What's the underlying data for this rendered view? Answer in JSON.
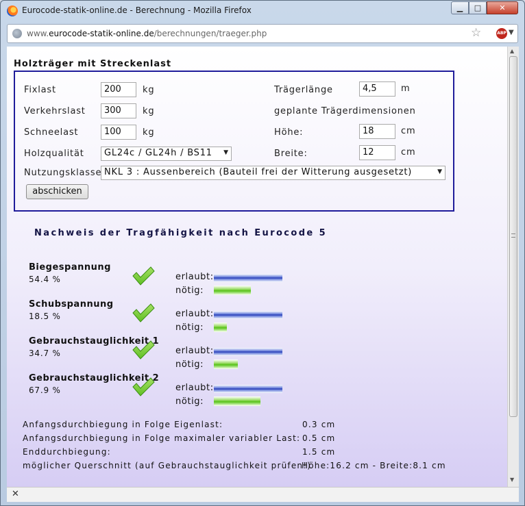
{
  "window": {
    "title": "Eurocode-statik-online.de - Berechnung - Mozilla Firefox",
    "min_symbol": "▁",
    "max_symbol": "□",
    "close_symbol": "✕"
  },
  "navbar": {
    "url_prefix": "www.",
    "url_domain": "eurocode-statik-online.de",
    "url_path": "/berechnungen/traeger.php",
    "abp_label": "ABP"
  },
  "form": {
    "heading": "Holzträger mit Streckenlast",
    "fixlast": {
      "label": "Fixlast",
      "value": "200",
      "unit": "kg"
    },
    "verkehrslast": {
      "label": "Verkehrslast",
      "value": "300",
      "unit": "kg"
    },
    "schneelast": {
      "label": "Schneelast",
      "value": "100",
      "unit": "kg"
    },
    "holzqualitaet": {
      "label": "Holzqualität",
      "value": "GL24c / GL24h / BS11"
    },
    "nutzungsklasse": {
      "label": "Nutzungsklasse",
      "value": "NKL 3 : Aussenbereich (Bauteil frei der Witterung ausgesetzt)"
    },
    "traegerlaenge": {
      "label": "Trägerlänge",
      "value": "4,5",
      "unit": "m"
    },
    "geplante": "geplante Trägerdimensionen",
    "hoehe": {
      "label": "Höhe:",
      "value": "18",
      "unit": "cm"
    },
    "breite": {
      "label": "Breite:",
      "value": "12",
      "unit": "cm"
    },
    "submit_label": "abschicken"
  },
  "nachweis": {
    "heading": "Nachweis der Tragfähigkeit nach Eurocode 5",
    "erlaubt_label": "erlaubt:",
    "noetig_label": "nötig:",
    "checks": [
      {
        "title": "Biegespannung",
        "percent_text": "54.4 %",
        "percent": 54.4
      },
      {
        "title": "Schubspannung",
        "percent_text": "18.5 %",
        "percent": 18.5
      },
      {
        "title": "Gebrauchstauglichkeit 1",
        "percent_text": "34.7 %",
        "percent": 34.7
      },
      {
        "title": "Gebrauchstauglichkeit 2",
        "percent_text": "67.9 %",
        "percent": 67.9
      }
    ]
  },
  "results": [
    {
      "label": "Anfangsdurchbiegung in Folge Eigenlast:",
      "value": "0.3 cm"
    },
    {
      "label": "Anfangsdurchbiegung in Folge maximaler variabler Last:",
      "value": "0.5 cm"
    },
    {
      "label": "Enddurchbiegung:",
      "value": "1.5 cm"
    },
    {
      "label": "möglicher Querschnitt (auf Gebrauchstauglichkeit prüfen!)",
      "value": "Höhe:16.2 cm - Breite:8.1 cm"
    }
  ],
  "status": {
    "close_symbol": "✕"
  },
  "colors": {
    "frame_border": "#1f1c9a",
    "bar_blue": "#2a3fb8",
    "bar_green": "#57c21a",
    "check_green": "#5fbf24"
  }
}
